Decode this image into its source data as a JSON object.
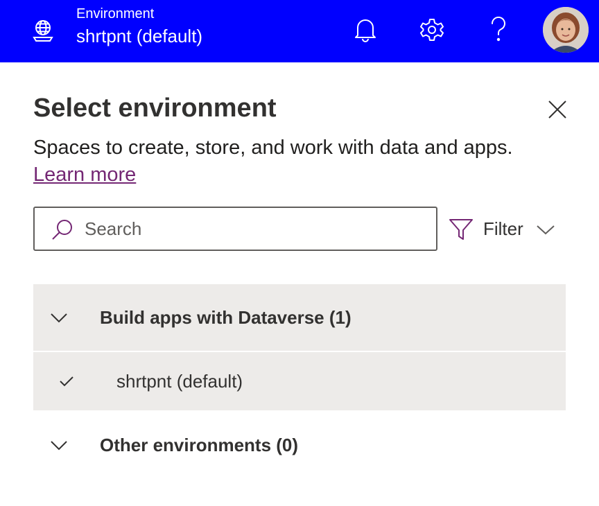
{
  "header": {
    "env_label": "Environment",
    "env_name": "shrtpnt (default)",
    "icons": [
      "globe-icon",
      "bell-icon",
      "gear-icon",
      "help-icon"
    ],
    "bg_color": "#0000ff"
  },
  "panel": {
    "title": "Select environment",
    "description": "Spaces to create, store, and work with data and apps.",
    "learn_more": "Learn more",
    "search_placeholder": "Search",
    "filter_label": "Filter"
  },
  "groups": [
    {
      "label": "Build apps with Dataverse (1)",
      "expanded": true,
      "items": [
        {
          "label": "shrtpnt (default)",
          "selected": true
        }
      ]
    },
    {
      "label": "Other environments (0)",
      "expanded": true,
      "items": []
    }
  ],
  "colors": {
    "accent": "#742774",
    "row_selected": "#edebe9"
  }
}
